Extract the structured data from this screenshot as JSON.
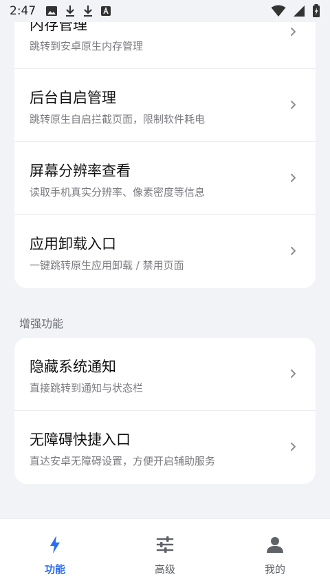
{
  "status_bar": {
    "time": "2:47",
    "left_icons": [
      "image-icon",
      "download-icon",
      "download-icon",
      "font-a-icon"
    ],
    "right_icons": [
      "wifi-icon",
      "signal-icon",
      "battery-charging-icon"
    ]
  },
  "card1": {
    "items": [
      {
        "title": "内存管理",
        "subtitle": "跳转到安卓原生内存管理"
      },
      {
        "title": "后台自启管理",
        "subtitle": "跳转原生自启拦截页面，限制软件耗电"
      },
      {
        "title": "屏幕分辨率查看",
        "subtitle": "读取手机真实分辨率、像素密度等信息"
      },
      {
        "title": "应用卸载入口",
        "subtitle": "一键跳转原生应用卸载 / 禁用页面"
      }
    ]
  },
  "section2": {
    "label": "增强功能",
    "items": [
      {
        "title": "隐藏系统通知",
        "subtitle": "直接跳转到通知与状态栏"
      },
      {
        "title": "无障碍快捷入口",
        "subtitle": "直达安卓无障碍设置，方便开启辅助服务"
      }
    ]
  },
  "nav": {
    "items": [
      {
        "label": "功能",
        "icon": "lightning-icon",
        "active": true
      },
      {
        "label": "高级",
        "icon": "sliders-icon",
        "active": false
      },
      {
        "label": "我的",
        "icon": "person-icon",
        "active": false
      }
    ],
    "active_color": "#2a6df4",
    "inactive_color": "#5f6368"
  }
}
